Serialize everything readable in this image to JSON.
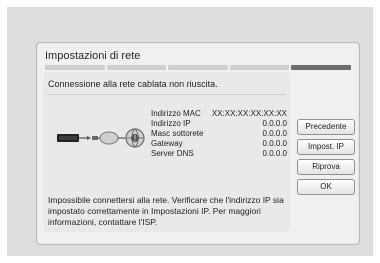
{
  "dialog": {
    "title": "Impostazioni di rete",
    "status": "Connessione alla rete cablata non riuscita.",
    "info": [
      {
        "label": "Indirizzo MAC",
        "value": "XX:XX:XX:XX:XX:XX"
      },
      {
        "label": "Indirizzo IP",
        "value": "0.0.0.0"
      },
      {
        "label": "Masc sottorete",
        "value": "0.0.0.0"
      },
      {
        "label": "Gateway",
        "value": "0.0.0.0"
      },
      {
        "label": "Server DNS",
        "value": "0.0.0.0"
      }
    ],
    "message": "Impossibile connettersi alla rete. Verificare che l'indirizzo IP sia impostato correttamente in Impostazioni IP. Per maggiori informazioni, contattare l'ISP.",
    "buttons": {
      "previous": "Precedente",
      "ip_settings": "Impost. IP",
      "retry": "Riprova",
      "ok": "OK"
    },
    "diagram_icons": [
      "device-icon",
      "cable-plug-icon",
      "router-icon",
      "globe-error-icon"
    ]
  },
  "colors": {
    "background": "#dedede",
    "dialog": "#f0f0f0",
    "content": "#e9e9e9",
    "text": "#1f1f1f"
  }
}
